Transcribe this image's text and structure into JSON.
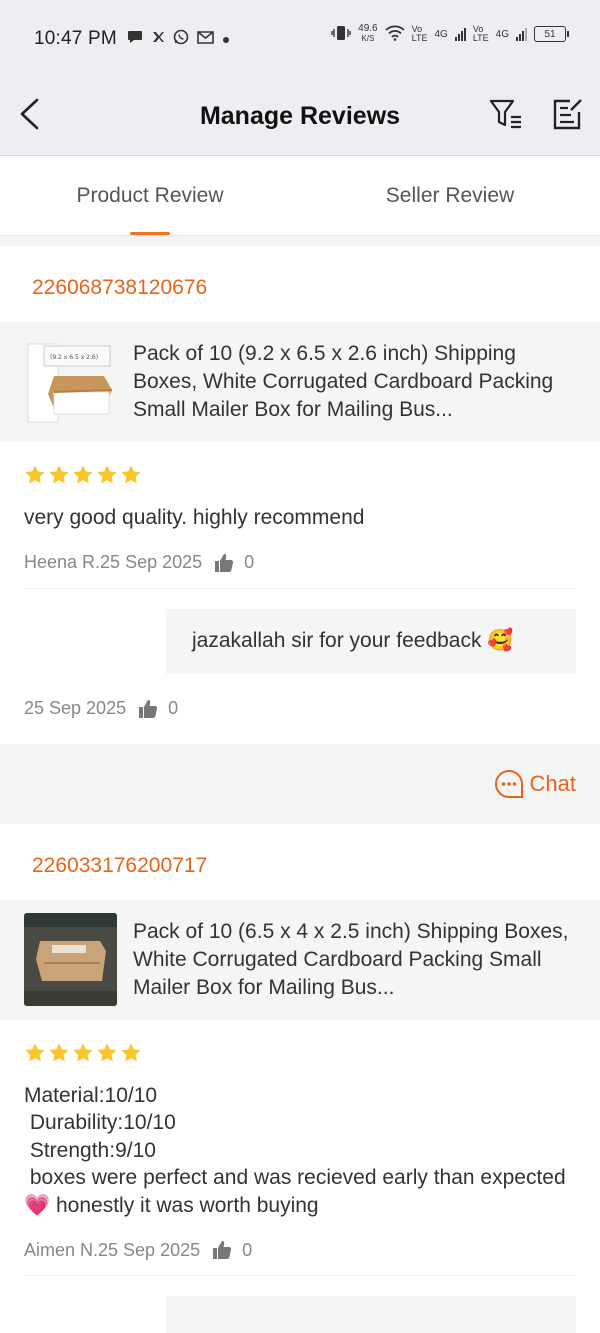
{
  "status_bar": {
    "time": "10:47 PM",
    "left_icons": [
      "chat-bubble-icon",
      "bird-icon",
      "whatsapp-icon",
      "gmail-icon",
      "dot-icon"
    ],
    "net_speed_value": "49.6",
    "net_speed_unit": "K/S",
    "volte1_top": "Vo",
    "volte1_bottom": "LTE",
    "net1": "4G",
    "volte2_top": "Vo",
    "volte2_bottom": "LTE",
    "net2": "4G",
    "battery": "51"
  },
  "header": {
    "title": "Manage Reviews",
    "back_icon": "chevron-left-icon",
    "filter_icon": "filter-icon",
    "edit_icon": "edit-icon"
  },
  "tabs": [
    {
      "label": "Product Review",
      "active": true
    },
    {
      "label": "Seller Review",
      "active": false
    }
  ],
  "reviews": [
    {
      "order_id": "226068738120676",
      "product_name": "Pack of 10 (9.2 x 6.5 x 2.6 inch) Shipping Boxes, White Corrugated Cardboard Packing Small Mailer Box for Mailing Bus...",
      "thumb_label": "(9.2 x 6.5 x 2.6)",
      "rating": 5,
      "text": "very good quality. highly recommend",
      "author_date": "Heena R.25 Sep 2025",
      "likes": "0",
      "reply": {
        "text": "jazakallah sir for your feedback 🥰",
        "date": "25 Sep 2025",
        "likes": "0"
      },
      "chat_label": "Chat"
    },
    {
      "order_id": "226033176200717",
      "product_name": "Pack of 10 (6.5 x 4 x 2.5 inch) Shipping Boxes, White Corrugated Cardboard Packing Small Mailer Box for Mailing Bus...",
      "rating": 5,
      "text": "Material:10/10\n Durability:10/10\n Strength:9/10\n boxes were perfect and was recieved early than expected💗 honestly it was worth buying",
      "author_date": "Aimen N.25 Sep 2025",
      "likes": "0"
    }
  ],
  "colors": {
    "accent": "#e8641b",
    "star": "#f9c52a",
    "header_bg": "#eceef2"
  }
}
